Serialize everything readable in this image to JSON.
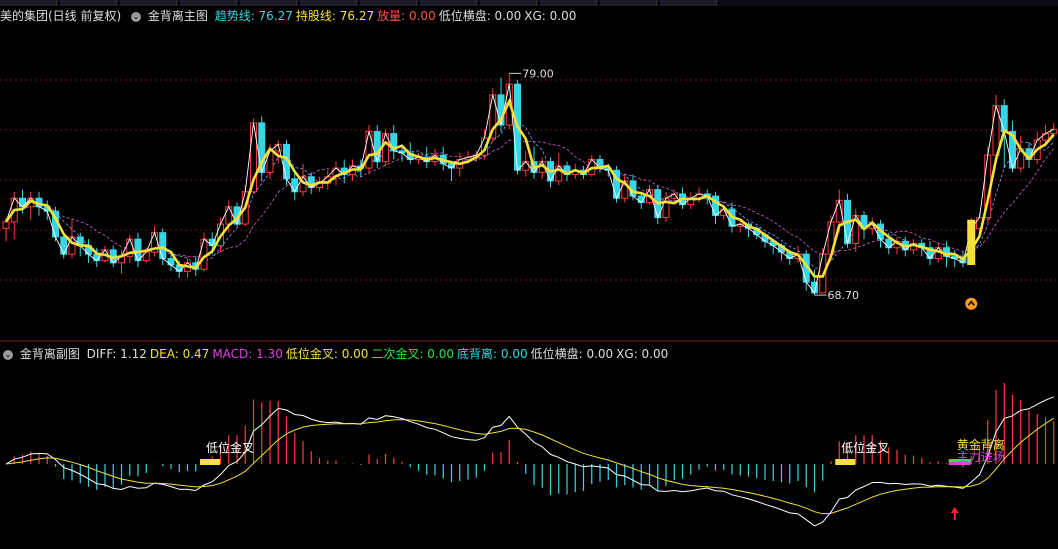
{
  "main_header": {
    "stock": "美的集团(日线 前复权)",
    "indicator": "金背离主图",
    "fields": [
      {
        "label": "趋势线:",
        "value": "76.27",
        "color": "#35d6e0"
      },
      {
        "label": "持股线:",
        "value": "76.27",
        "color": "#f5e13a"
      },
      {
        "label": "放量:",
        "value": "0.00",
        "color": "#ff4d4d"
      },
      {
        "label": "低位横盘:",
        "value": "0.00",
        "color": "#dddddd"
      },
      {
        "label": "XG:",
        "value": "0.00",
        "color": "#dddddd"
      }
    ]
  },
  "sub_header": {
    "indicator": "金背离副图",
    "fields": [
      {
        "label": "DIFF:",
        "value": "1.12",
        "color": "#dddddd"
      },
      {
        "label": "DEA:",
        "value": "0.47",
        "color": "#f5e13a"
      },
      {
        "label": "MACD:",
        "value": "1.30",
        "color": "#e040e0"
      },
      {
        "label": "低位金叉:",
        "value": "0.00",
        "color": "#f5e13a"
      },
      {
        "label": "二次金叉:",
        "value": "0.00",
        "color": "#35e04a"
      },
      {
        "label": "底背离:",
        "value": "0.00",
        "color": "#35d6e0"
      },
      {
        "label": "低位横盘:",
        "value": "0.00",
        "color": "#dddddd"
      },
      {
        "label": "XG:",
        "value": "0.00",
        "color": "#dddddd"
      }
    ]
  },
  "colors": {
    "up": "#ff3b3b",
    "down": "#37d6e6",
    "trend": "#f5e13a",
    "diff": "#ffffff",
    "dea": "#f5e13a",
    "grid": "#7a1010"
  },
  "chart_data": [
    {
      "type": "candlestick",
      "ylim": [
        66.8,
        81.2
      ],
      "annotations": [
        {
          "text": "79.00",
          "price": 79.0
        },
        {
          "text": "68.70",
          "price": 68.7
        }
      ],
      "candles": [
        [
          71.8,
          72.1,
          72.3,
          71.2
        ],
        [
          72.1,
          73.2,
          73.5,
          71.3
        ],
        [
          73.2,
          72.8,
          73.6,
          72.5
        ],
        [
          72.8,
          73.2,
          73.5,
          72.2
        ],
        [
          73.2,
          72.8,
          73.5,
          72.4
        ],
        [
          72.8,
          72.6,
          73.1,
          72.2
        ],
        [
          72.6,
          71.4,
          72.8,
          71.2
        ],
        [
          71.4,
          70.6,
          71.6,
          70.4
        ],
        [
          70.6,
          71.4,
          72.2,
          70.4
        ],
        [
          71.4,
          71.0,
          71.6,
          70.5
        ],
        [
          71.0,
          70.6,
          71.3,
          70.2
        ],
        [
          70.6,
          70.3,
          70.9,
          70.0
        ],
        [
          70.3,
          70.8,
          71.0,
          70.2
        ],
        [
          70.8,
          70.2,
          71.0,
          70.0
        ],
        [
          70.2,
          70.5,
          70.8,
          69.7
        ],
        [
          70.5,
          71.3,
          71.5,
          70.2
        ],
        [
          71.3,
          70.3,
          71.6,
          70.0
        ],
        [
          70.3,
          70.7,
          70.9,
          70.2
        ],
        [
          70.7,
          71.6,
          71.9,
          70.5
        ],
        [
          71.6,
          70.4,
          71.8,
          70.1
        ],
        [
          70.4,
          70.1,
          70.6,
          69.8
        ],
        [
          70.1,
          69.8,
          70.3,
          69.5
        ],
        [
          69.8,
          70.2,
          70.4,
          69.5
        ],
        [
          70.2,
          69.9,
          70.5,
          69.6
        ],
        [
          69.9,
          71.3,
          71.6,
          69.8
        ],
        [
          71.3,
          71.0,
          71.6,
          70.6
        ],
        [
          71.0,
          72.0,
          72.3,
          70.7
        ],
        [
          72.0,
          72.8,
          73.1,
          71.6
        ],
        [
          72.8,
          72.0,
          73.0,
          71.9
        ],
        [
          72.0,
          73.5,
          73.8,
          71.9
        ],
        [
          73.5,
          76.7,
          76.9,
          73.4
        ],
        [
          76.7,
          74.4,
          77.0,
          74.0
        ],
        [
          74.4,
          75.4,
          75.7,
          74.1
        ],
        [
          75.4,
          75.7,
          75.9,
          74.8
        ],
        [
          75.7,
          74.1,
          75.9,
          73.8
        ],
        [
          74.1,
          73.5,
          74.4,
          73.1
        ],
        [
          73.5,
          74.2,
          74.8,
          73.3
        ],
        [
          74.2,
          73.7,
          74.4,
          73.4
        ],
        [
          73.7,
          73.9,
          74.2,
          73.5
        ],
        [
          73.9,
          74.2,
          74.5,
          73.6
        ],
        [
          74.2,
          74.6,
          74.9,
          73.8
        ],
        [
          74.6,
          74.3,
          75.0,
          73.9
        ],
        [
          74.3,
          74.7,
          75.0,
          74.0
        ],
        [
          74.7,
          74.6,
          75.0,
          74.2
        ],
        [
          74.6,
          76.3,
          76.6,
          74.3
        ],
        [
          76.3,
          74.9,
          76.6,
          74.6
        ],
        [
          74.9,
          76.2,
          76.4,
          74.7
        ],
        [
          76.2,
          75.4,
          76.6,
          75.0
        ],
        [
          75.4,
          75.3,
          75.6,
          74.9
        ],
        [
          75.3,
          75.0,
          75.8,
          74.8
        ],
        [
          75.0,
          75.1,
          75.3,
          74.8
        ],
        [
          75.1,
          74.9,
          75.6,
          74.6
        ],
        [
          74.9,
          75.2,
          75.5,
          74.7
        ],
        [
          75.2,
          74.8,
          75.6,
          74.5
        ],
        [
          74.8,
          74.6,
          74.9,
          74.0
        ],
        [
          74.6,
          75.0,
          75.3,
          74.2
        ],
        [
          75.0,
          75.1,
          75.4,
          74.8
        ],
        [
          75.1,
          75.2,
          75.4,
          74.9
        ],
        [
          75.2,
          76.0,
          76.4,
          75.0
        ],
        [
          76.0,
          78.0,
          78.3,
          75.8
        ],
        [
          78.0,
          76.6,
          78.8,
          76.3
        ],
        [
          76.6,
          78.5,
          79.0,
          76.4
        ],
        [
          78.5,
          74.5,
          78.7,
          74.3
        ],
        [
          74.5,
          74.9,
          75.4,
          74.2
        ],
        [
          74.9,
          74.4,
          75.6,
          74.1
        ],
        [
          74.4,
          74.9,
          75.1,
          74.1
        ],
        [
          74.9,
          74.0,
          75.1,
          73.7
        ],
        [
          74.0,
          74.7,
          75.3,
          73.8
        ],
        [
          74.7,
          74.3,
          74.9,
          74.0
        ],
        [
          74.3,
          74.5,
          74.8,
          74.1
        ],
        [
          74.5,
          74.3,
          74.7,
          74.1
        ],
        [
          74.3,
          75.0,
          75.2,
          74.2
        ],
        [
          75.0,
          74.6,
          75.2,
          74.4
        ],
        [
          74.6,
          74.5,
          74.8,
          74.2
        ],
        [
          74.5,
          73.2,
          74.7,
          73.0
        ],
        [
          73.2,
          74.0,
          74.3,
          73.0
        ],
        [
          74.0,
          73.3,
          74.3,
          73.1
        ],
        [
          73.3,
          73.0,
          73.5,
          72.7
        ],
        [
          73.0,
          73.6,
          73.8,
          72.9
        ],
        [
          73.6,
          72.3,
          73.8,
          72.0
        ],
        [
          72.3,
          73.2,
          73.5,
          72.1
        ],
        [
          73.2,
          73.4,
          73.6,
          72.9
        ],
        [
          73.4,
          72.9,
          73.7,
          72.7
        ],
        [
          72.9,
          73.2,
          73.5,
          72.7
        ],
        [
          73.2,
          73.4,
          73.7,
          73.0
        ],
        [
          73.4,
          73.3,
          73.6,
          72.9
        ],
        [
          73.3,
          72.4,
          73.5,
          72.0
        ],
        [
          72.4,
          72.7,
          72.9,
          72.2
        ],
        [
          72.7,
          71.9,
          73.0,
          71.6
        ],
        [
          71.9,
          72.0,
          72.2,
          71.6
        ],
        [
          72.0,
          71.8,
          72.1,
          71.4
        ],
        [
          71.8,
          71.5,
          71.9,
          71.3
        ],
        [
          71.5,
          71.2,
          71.6,
          70.9
        ],
        [
          71.2,
          71.0,
          71.3,
          70.6
        ],
        [
          71.0,
          70.7,
          71.1,
          70.3
        ],
        [
          70.7,
          70.4,
          70.8,
          70.1
        ],
        [
          70.4,
          70.6,
          71.0,
          70.2
        ],
        [
          70.6,
          69.3,
          70.8,
          68.9
        ],
        [
          69.3,
          68.8,
          69.9,
          68.7
        ],
        [
          68.8,
          70.6,
          70.9,
          68.8
        ],
        [
          70.6,
          72.1,
          72.4,
          70.3
        ],
        [
          72.1,
          73.1,
          73.6,
          71.6
        ],
        [
          73.1,
          71.1,
          73.4,
          70.9
        ],
        [
          71.1,
          72.4,
          72.7,
          70.7
        ],
        [
          72.4,
          71.8,
          72.6,
          71.3
        ],
        [
          71.8,
          72.0,
          72.3,
          71.5
        ],
        [
          72.0,
          71.3,
          72.2,
          70.9
        ],
        [
          71.3,
          70.9,
          71.6,
          70.6
        ],
        [
          70.9,
          71.2,
          71.4,
          70.6
        ],
        [
          71.2,
          70.8,
          71.4,
          70.5
        ],
        [
          70.8,
          71.1,
          71.3,
          70.6
        ],
        [
          71.1,
          70.9,
          71.3,
          70.5
        ],
        [
          70.9,
          70.4,
          71.2,
          70.1
        ],
        [
          70.4,
          70.9,
          71.1,
          70.2
        ],
        [
          70.9,
          70.5,
          71.2,
          70.0
        ],
        [
          70.5,
          70.4,
          70.8,
          70.0
        ],
        [
          70.4,
          70.2,
          70.7,
          70.0
        ],
        [
          70.2,
          71.8,
          72.3,
          70.1
        ],
        [
          71.8,
          72.3,
          72.5,
          71.6
        ],
        [
          72.3,
          75.2,
          75.6,
          72.1
        ],
        [
          75.2,
          77.5,
          78.0,
          75.0
        ],
        [
          77.5,
          76.3,
          77.8,
          74.6
        ],
        [
          76.3,
          74.6,
          76.8,
          74.4
        ],
        [
          74.6,
          75.5,
          76.1,
          74.4
        ],
        [
          75.5,
          75.0,
          75.8,
          74.6
        ],
        [
          75.0,
          75.9,
          76.3,
          74.8
        ],
        [
          75.9,
          76.2,
          76.6,
          75.6
        ],
        [
          76.2,
          76.4,
          76.7,
          76.0
        ]
      ]
    },
    {
      "type": "macd",
      "labels": [
        "低位金叉",
        "低位金叉",
        "黄金背离",
        "主力进场"
      ]
    }
  ]
}
